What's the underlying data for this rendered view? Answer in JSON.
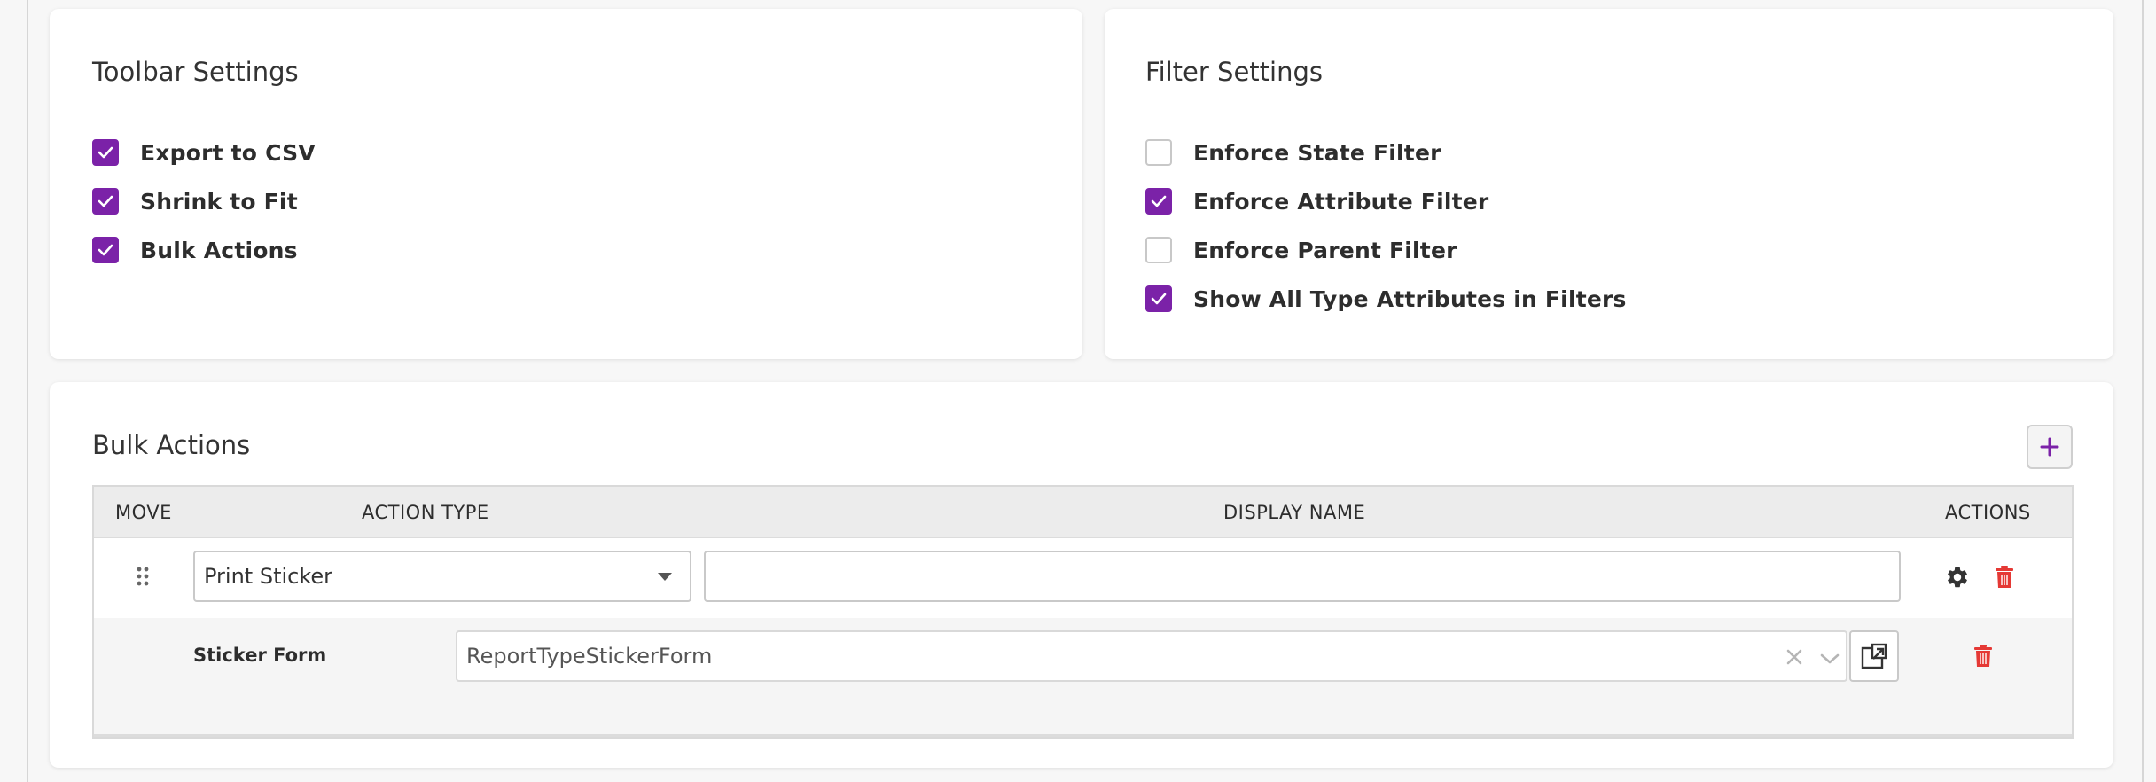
{
  "toolbar_settings": {
    "title": "Toolbar Settings",
    "options": [
      {
        "label": "Export to CSV",
        "checked": true
      },
      {
        "label": "Shrink to Fit",
        "checked": true
      },
      {
        "label": "Bulk Actions",
        "checked": true
      }
    ]
  },
  "filter_settings": {
    "title": "Filter Settings",
    "options": [
      {
        "label": "Enforce State Filter",
        "checked": false
      },
      {
        "label": "Enforce Attribute Filter",
        "checked": true
      },
      {
        "label": "Enforce Parent Filter",
        "checked": false
      },
      {
        "label": "Show All Type Attributes in Filters",
        "checked": true
      }
    ]
  },
  "bulk_actions": {
    "title": "Bulk Actions",
    "columns": [
      "MOVE",
      "ACTION TYPE",
      "DISPLAY NAME",
      "ACTIONS"
    ],
    "row": {
      "action_type": "Print Sticker",
      "display_name": "",
      "sub_field": {
        "label": "Sticker Form",
        "value": "ReportTypeStickerForm"
      }
    }
  },
  "colors": {
    "accent": "#7b22a8",
    "danger": "#e53935"
  },
  "icons": [
    "check-icon",
    "plus-icon",
    "drag-handle-icon",
    "caret-down-icon",
    "gear-icon",
    "trash-icon",
    "clear-x-icon",
    "chevron-down-icon",
    "external-link-icon"
  ]
}
